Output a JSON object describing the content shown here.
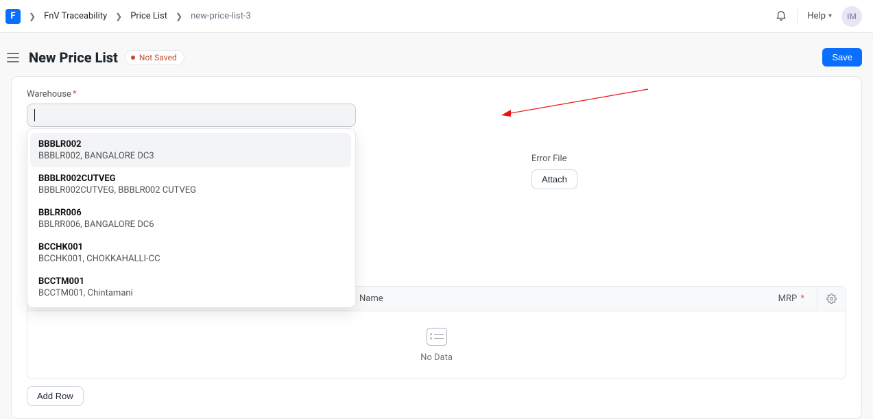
{
  "breadcrumb": {
    "items": [
      "FnV Traceability",
      "Price List",
      "new-price-list-3"
    ]
  },
  "header": {
    "help_label": "Help",
    "avatar_initials": "IM"
  },
  "page": {
    "title": "New Price List",
    "status": "Not Saved",
    "save_label": "Save"
  },
  "form": {
    "warehouse_label": "Warehouse",
    "warehouse_value": "",
    "error_file_label": "Error File",
    "attach_label": "Attach"
  },
  "warehouse_options": [
    {
      "title": "BBBLR002",
      "desc": "BBBLR002, BANGALORE DC3"
    },
    {
      "title": "BBBLR002CUTVEG",
      "desc": "BBBLR002CUTVEG, BBBLR002 CUTVEG"
    },
    {
      "title": "BBLRR006",
      "desc": "BBLRR006, BANGALORE DC6"
    },
    {
      "title": "BCCHK001",
      "desc": "BCCHK001, CHOKKAHALLI-CC"
    },
    {
      "title": "BCCTM001",
      "desc": "BCCTM001, Chintamani"
    }
  ],
  "table": {
    "columns": {
      "name": "Name",
      "mrp": "MRP"
    },
    "no_data": "No Data",
    "add_row_label": "Add Row"
  }
}
